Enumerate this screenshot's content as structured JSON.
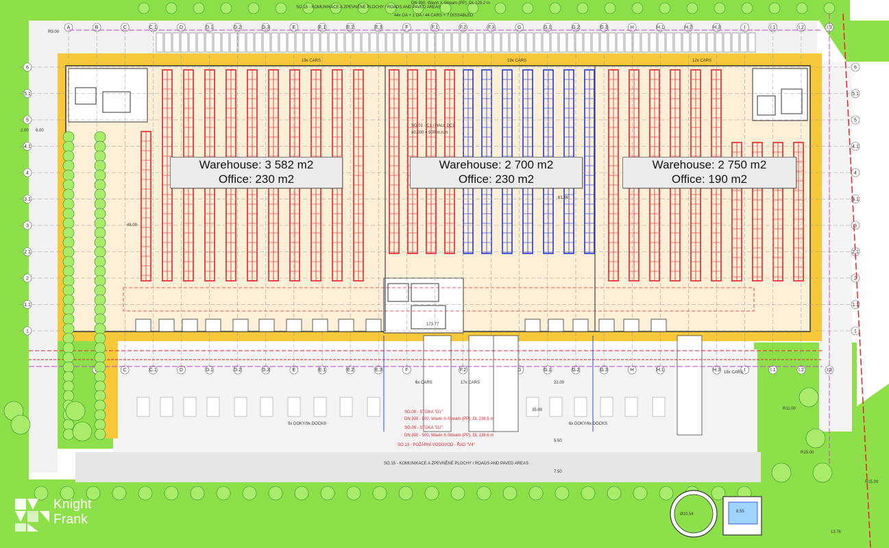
{
  "zones": [
    {
      "warehouse": "Warehouse: 3 582 m2",
      "office": "Office: 230 m2"
    },
    {
      "warehouse": "Warehouse: 2 700 m2",
      "office": "Office: 230 m2"
    },
    {
      "warehouse": "Warehouse: 2 750 m2",
      "office": "Office: 190 m2"
    }
  ],
  "hall": {
    "code": "SO.01 - C1 / HALL DC1",
    "level": "±0.000 = 500 m.n.m",
    "width_dim": "173.77"
  },
  "road_labels": {
    "top": "SO.15 - KOMUNIKACE A ZPEVNĚNÉ PLOCHY / ROADS AND PAVED AREAS",
    "bottom": "SO.15 - KOMUNIKACE A ZPEVNĚNÉ PLOCHY / ROADS AND PAVED AREAS"
  },
  "parking_labels": {
    "top_summary": "44x OA + 1 OA / 44 CARS + 7 DISSABLED",
    "cars_19_left": "19x CARS",
    "cars_19_mid": "19x CARS",
    "cars_12": "12x CARS",
    "cars_6": "6x CARS",
    "cars_17": "17x CARS",
    "cars_18": "18x CARS"
  },
  "docks": {
    "left": "9x DOKY/9x DOCKS",
    "right": "6x DOKY/6x DOCKS"
  },
  "utility_labels": {
    "sewer_1": "SO.09 - STOKA \"D1\"",
    "sewer_1_spec": "DN 300 - 500, Wavin X-Stream (PP), DL 236.5 m",
    "sewer_2": "SO.09 - STOKA \"D2\"",
    "sewer_2_spec": "DN 300 - 500, Wavin X-Stream (PP), DL 136.6 m",
    "fire_water": "SO.13 - POŽÁRNÍ VODOVOD - ŘAD \"V4\"",
    "top_pipe": "DN 300, Wavin X-Stream (PP), DL 128.2 m"
  },
  "dimensions": {
    "d_6_00": "6.00",
    "d_2_00": "2.00",
    "d_22_00": "22.00",
    "d_35_00": "35.00",
    "d_5_50": "5.50",
    "d_7_50": "7.50",
    "d_13_76": "13.76",
    "d_r11": "R11.00",
    "d_r15": "R15.00",
    "d_r15b": "R15.00",
    "d_tank": "Ø10.54",
    "d_tank2": "8.55",
    "d_48": "48.00",
    "d_61": "61.36",
    "d_r9": "R9.00"
  },
  "grid_columns": [
    "A",
    "B",
    "C",
    "C.1",
    "D",
    "D.1",
    "D.2",
    "D.3",
    "E",
    "E.1",
    "E.2",
    "E.3",
    "F",
    "F.1",
    "F.2",
    "F.3",
    "G",
    "G.1",
    "G.2",
    "G.3",
    "H",
    "H.1",
    "H.2",
    "H.3",
    "I",
    "I.1",
    "I.2",
    "I.3"
  ],
  "grid_rows": [
    "6",
    "5.1",
    "5",
    "4.1",
    "4",
    "3.1",
    "3",
    "2.1",
    "2",
    "1.1",
    "1"
  ],
  "branding": {
    "logo_line1": "Knight",
    "logo_line2": "Frank"
  },
  "colors": {
    "grass": "#8ee04a",
    "paved": "#f0f0f0",
    "floor": "#fcefd8",
    "wall": "#f7c83a",
    "rack_red": "#e8202a",
    "rack_blue": "#1f37d8",
    "grid": "#9a9a9a"
  }
}
